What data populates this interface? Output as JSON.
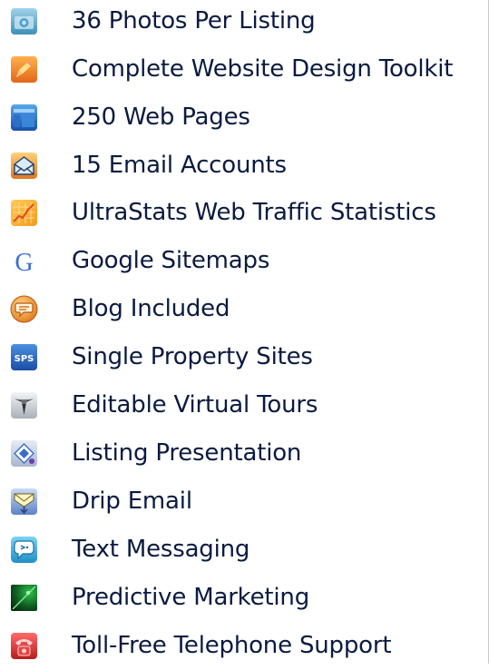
{
  "colors": {
    "text": "#0a1a40",
    "background": "#ffffff"
  },
  "features": [
    {
      "label": "36 Photos Per Listing",
      "icon": "camera-icon"
    },
    {
      "label": "Complete Website Design Toolkit",
      "icon": "pencil-icon"
    },
    {
      "label": "250 Web Pages",
      "icon": "web-pages-icon"
    },
    {
      "label": "15 Email Accounts",
      "icon": "envelope-icon"
    },
    {
      "label": "UltraStats Web Traffic Statistics",
      "icon": "stats-chart-icon"
    },
    {
      "label": "Google Sitemaps",
      "icon": "google-g-icon"
    },
    {
      "label": "Blog Included",
      "icon": "blog-bubble-icon"
    },
    {
      "label": "Single Property Sites",
      "icon": "sps-icon",
      "icon_text": "SPS"
    },
    {
      "label": "Editable Virtual Tours",
      "icon": "virtual-tour-icon"
    },
    {
      "label": "Listing Presentation",
      "icon": "presentation-icon"
    },
    {
      "label": "Drip Email",
      "icon": "drip-email-icon"
    },
    {
      "label": "Text Messaging",
      "icon": "text-message-icon"
    },
    {
      "label": "Predictive Marketing",
      "icon": "radar-icon"
    },
    {
      "label": "Toll-Free Telephone Support",
      "icon": "telephone-icon"
    }
  ]
}
